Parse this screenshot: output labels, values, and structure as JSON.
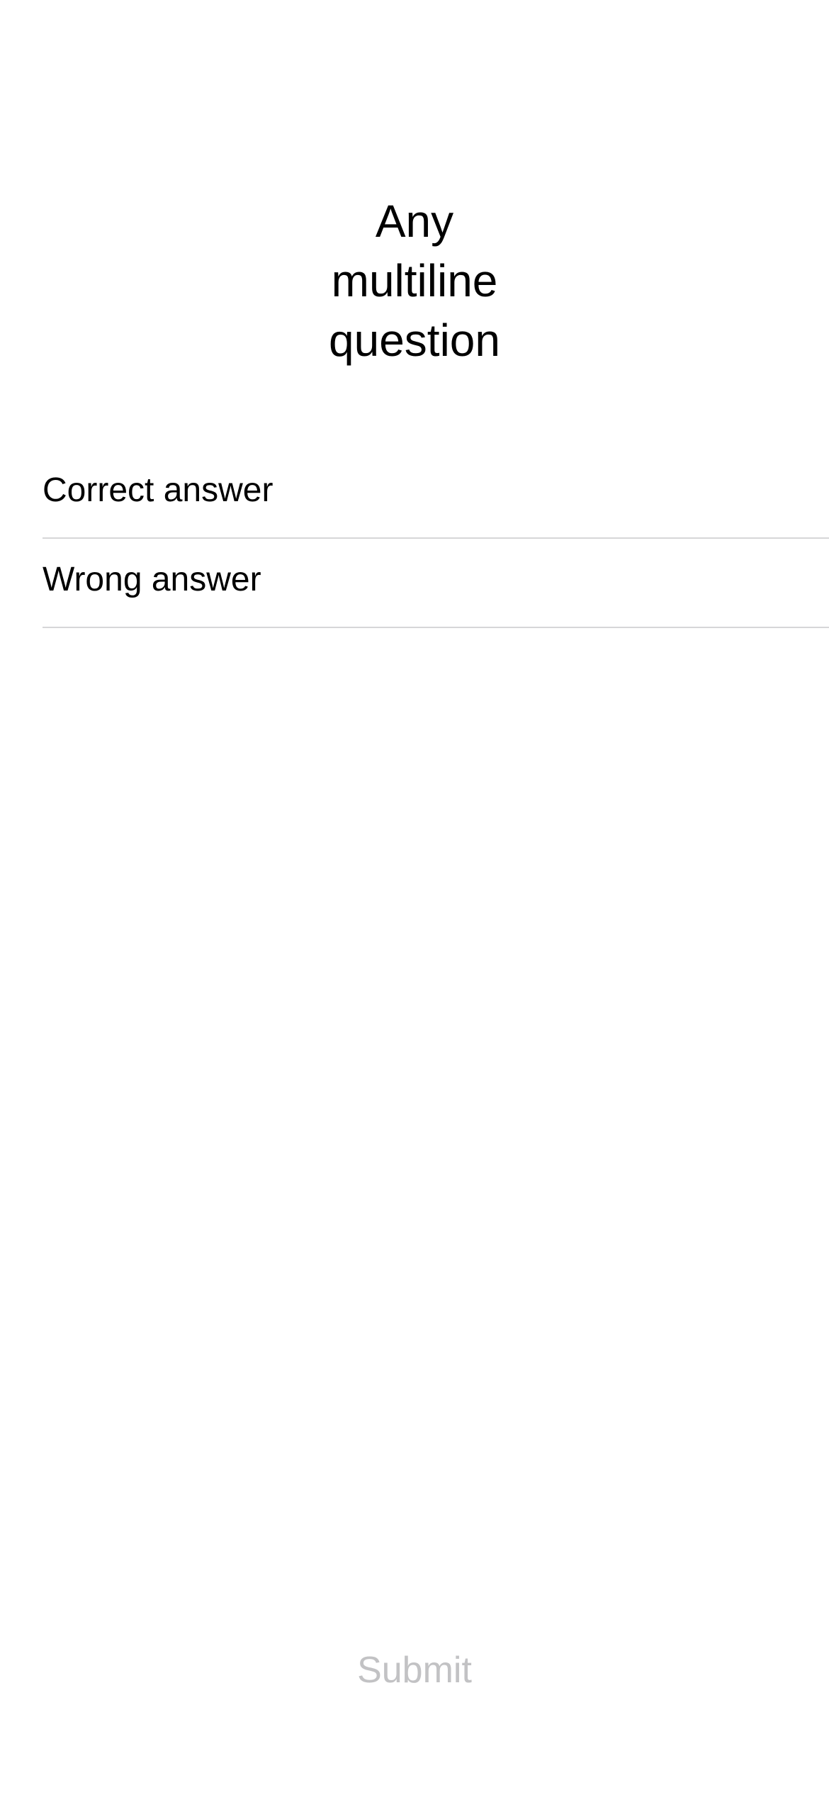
{
  "question": {
    "lines": [
      "Any",
      "multiline",
      "question"
    ]
  },
  "answers": [
    {
      "label": "Correct answer"
    },
    {
      "label": "Wrong answer"
    }
  ],
  "submit": {
    "label": "Submit",
    "enabled": false,
    "color": "#c2c2c4"
  },
  "colors": {
    "background": "#ffffff",
    "text": "#000000",
    "separator": "#d6d6d8"
  }
}
